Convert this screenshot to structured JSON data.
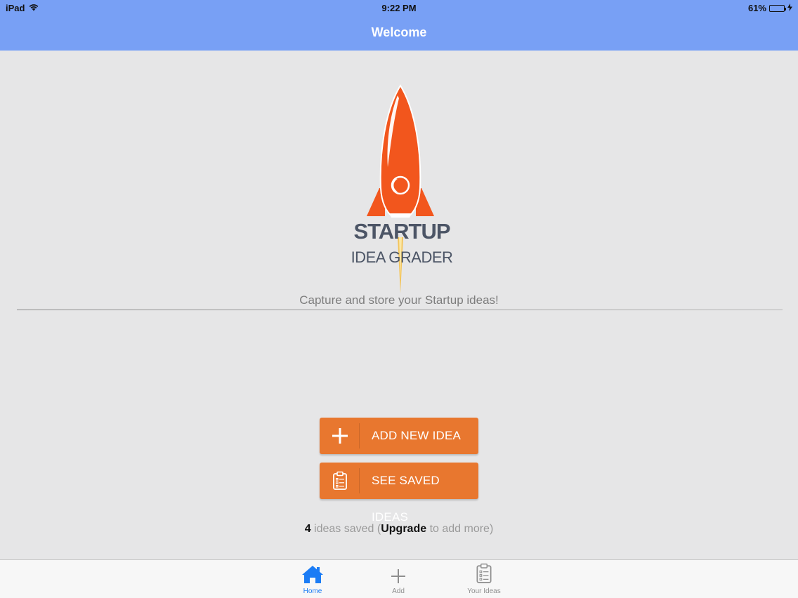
{
  "status_bar": {
    "device": "iPad",
    "time": "9:22 PM",
    "battery": "61%",
    "battery_level": 0.61
  },
  "nav": {
    "title": "Welcome"
  },
  "logo": {
    "line1": "STARTUP",
    "line2": "IDEA GRADER",
    "colors": {
      "rocket": "#f2561d",
      "text": "#4c5566",
      "flame": "#f4c04a"
    }
  },
  "tagline": "Capture and store your Startup ideas!",
  "buttons": {
    "add": {
      "label": "ADD NEW IDEA",
      "icon": "plus-icon"
    },
    "saved": {
      "label": "SEE SAVED IDEAS",
      "icon": "clipboard-icon"
    },
    "color": "#e8772f"
  },
  "footer": {
    "count": "4",
    "text_before": " ideas saved (",
    "upgrade": "Upgrade",
    "text_after": " to add more)"
  },
  "tabs": [
    {
      "label": "Home",
      "icon": "home-icon",
      "active": true
    },
    {
      "label": "Add",
      "icon": "plus-icon",
      "active": false
    },
    {
      "label": "Your Ideas",
      "icon": "clipboard-icon",
      "active": false
    }
  ],
  "colors": {
    "header": "#78a0f5",
    "background": "#e6e6e7",
    "tab_active": "#1b7cf5",
    "tab_inactive": "#8e8e8e"
  }
}
